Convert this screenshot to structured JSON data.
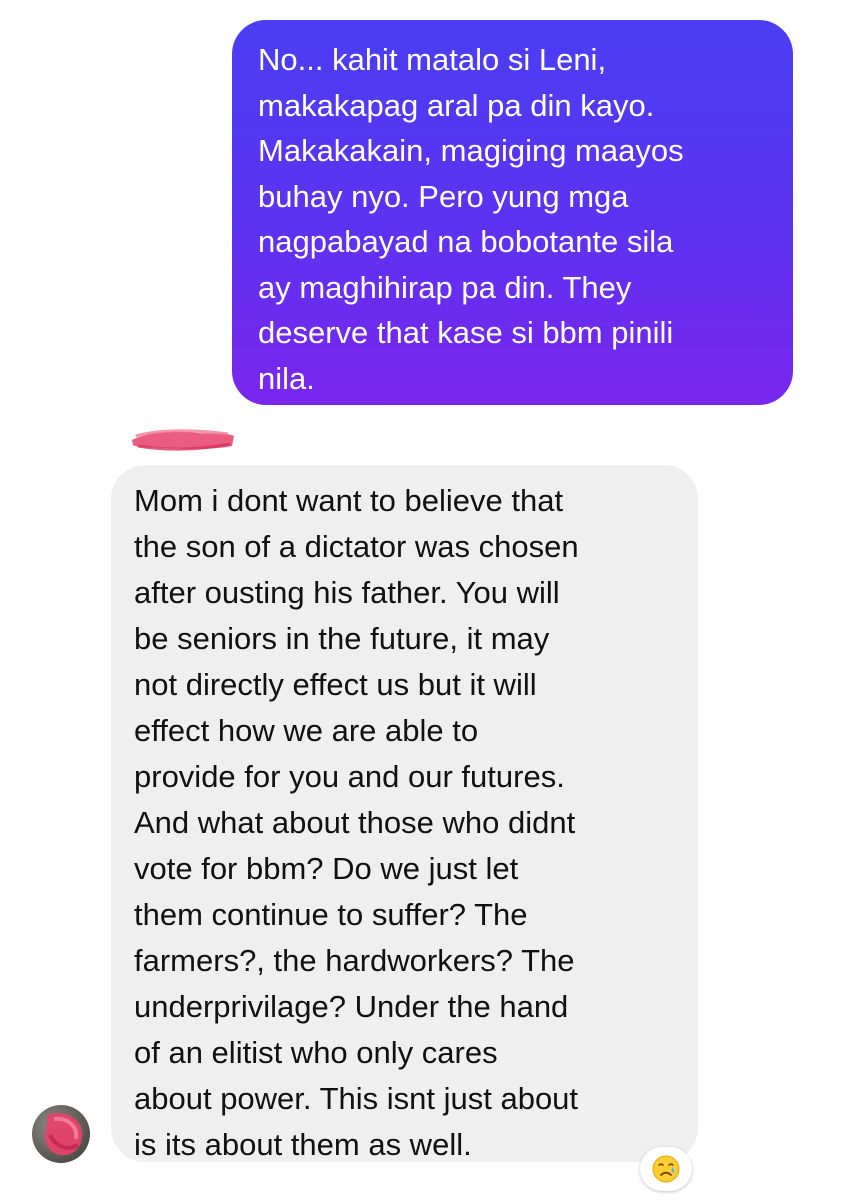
{
  "conversation": {
    "sent_message": {
      "text": "No... kahit matalo si Leni,\nmakakapag aral pa din kayo.\nMakakakain, magiging maayos\nbuhay nyo. Pero yung mga\nnagpabayad na bobotante sila\nay maghihirap pa din. They\ndeserve that kase si bbm pinili\nnila."
    },
    "received_message": {
      "text": "Mom i dont want to believe that\nthe son of a dictator was chosen\nafter ousting his father. You will\nbe seniors in the future, it may\nnot directly effect us but it will\neffect how we are able to\nprovide for you and our futures.\nAnd what about those who didnt\nvote for bbm? Do we just let\nthem continue to suffer? The\nfarmers?, the hardworkers? The\nunderprivilage? Under the hand\nof an elitist who only cares\nabout power. This isnt just about\nis its about them as well.",
      "reaction": "crying-face-icon"
    }
  },
  "colors": {
    "sent_gradient_top": "#4a3ef3",
    "sent_gradient_bottom": "#7a26ee",
    "received_bubble": "#efefef",
    "redaction": "#e8416a"
  }
}
